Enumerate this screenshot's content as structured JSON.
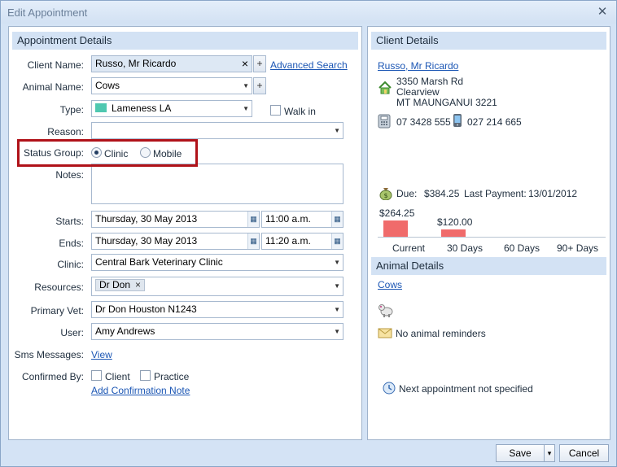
{
  "window": {
    "title": "Edit Appointment",
    "close_glyph": "✕"
  },
  "left": {
    "section_title": "Appointment Details",
    "client_name": {
      "label": "Client Name:",
      "value": "Russo, Mr Ricardo",
      "clear": "×",
      "add": "+",
      "advanced_search": "Advanced Search"
    },
    "animal_name": {
      "label": "Animal Name:",
      "value": "Cows",
      "add": "+"
    },
    "type": {
      "label": "Type:",
      "value": "Lameness LA",
      "color": "#4fc8b0"
    },
    "walk_in": {
      "label": "Walk in",
      "checked": false
    },
    "reason": {
      "label": "Reason:",
      "value": ""
    },
    "status_group": {
      "label": "Status Group:",
      "options": [
        "Clinic",
        "Mobile"
      ],
      "selected": "Clinic"
    },
    "notes": {
      "label": "Notes:",
      "value": ""
    },
    "starts": {
      "label": "Starts:",
      "date": "Thursday, 30 May 2013",
      "time": "11:00 a.m."
    },
    "ends": {
      "label": "Ends:",
      "date": "Thursday, 30 May 2013",
      "time": "11:20 a.m."
    },
    "clinic": {
      "label": "Clinic:",
      "value": "Central Bark Veterinary Clinic"
    },
    "resources": {
      "label": "Resources:",
      "chip": "Dr Don",
      "chip_x": "×"
    },
    "primary_vet": {
      "label": "Primary Vet:",
      "value": "Dr Don Houston N1243"
    },
    "user": {
      "label": "User:",
      "value": "Amy Andrews"
    },
    "sms": {
      "label": "Sms Messages:",
      "link": "View"
    },
    "confirmed_by": {
      "label": "Confirmed By:",
      "options": [
        "Client",
        "Practice"
      ],
      "add_note": "Add Confirmation Note"
    }
  },
  "right": {
    "client_section_title": "Client Details",
    "client_link": "Russo, Mr Ricardo",
    "address": [
      "3350 Marsh Rd",
      "Clearview",
      "MT MAUNGANUI  3221"
    ],
    "phone": "07 3428 555",
    "mobile": "027 214 665",
    "due_label": "Due:",
    "due_value": "$384.25",
    "last_payment_label": "Last Payment:",
    "last_payment_value": "13/01/2012",
    "aging": {
      "categories": [
        "Current",
        "30 Days",
        "60 Days",
        "90+ Days"
      ],
      "values": [
        264.25,
        120.0,
        0,
        0
      ],
      "labels": [
        "$264.25",
        "$120.00",
        "",
        ""
      ],
      "color": "#f06b6b"
    },
    "animal_section_title": "Animal Details",
    "animal_link": "Cows",
    "reminders": "No animal reminders",
    "next_appointment": "Next appointment not specified"
  },
  "footer": {
    "save": "Save",
    "save_arrow": "▾",
    "cancel": "Cancel"
  },
  "glyphs": {
    "dropdown": "▼",
    "calendar": "▦"
  }
}
